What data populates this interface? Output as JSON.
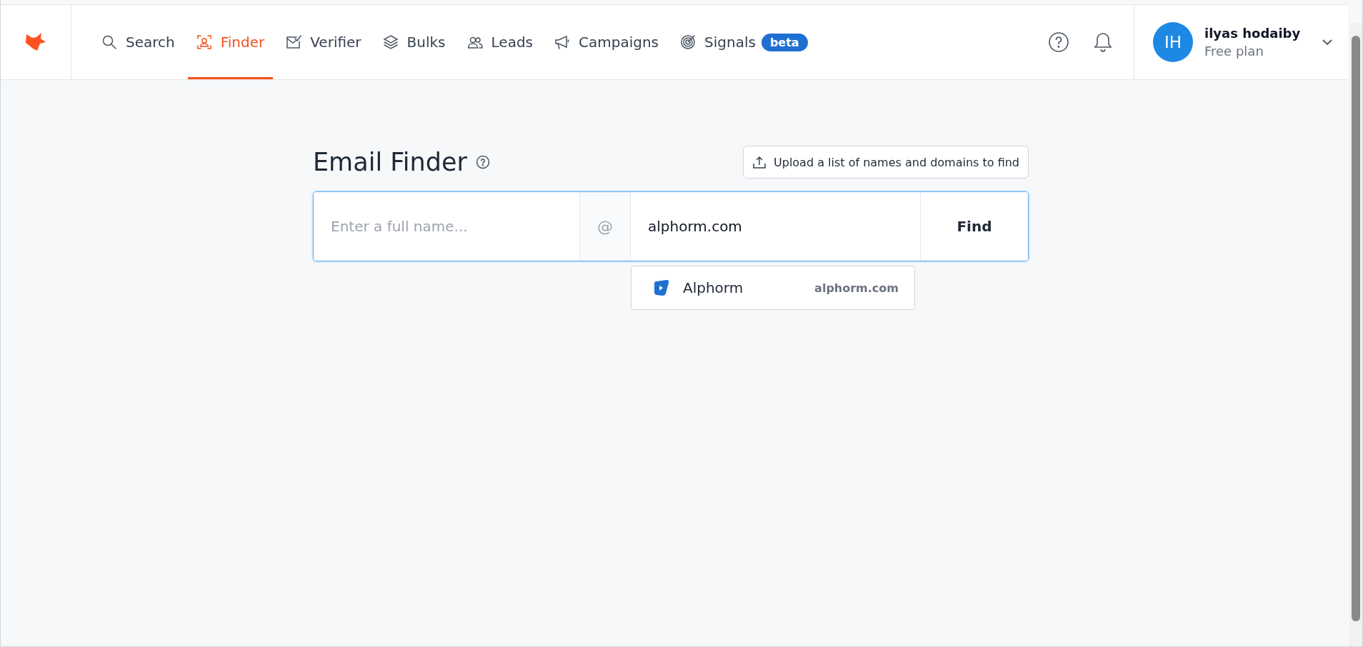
{
  "nav": {
    "tabs": [
      {
        "label": "Search",
        "kind": "search",
        "selected": false
      },
      {
        "label": "Finder",
        "kind": "finder",
        "selected": true
      },
      {
        "label": "Verifier",
        "kind": "verifier",
        "selected": false
      },
      {
        "label": "Bulks",
        "kind": "bulks",
        "selected": false
      },
      {
        "label": "Leads",
        "kind": "leads",
        "selected": false
      },
      {
        "label": "Campaigns",
        "kind": "campaigns",
        "selected": false
      },
      {
        "label": "Signals",
        "kind": "signals",
        "selected": false,
        "badge": "beta"
      }
    ]
  },
  "user": {
    "initials": "IH",
    "name": "ilyas hodaiby",
    "plan": "Free plan"
  },
  "page": {
    "title": "Email Finder",
    "upload_button": "Upload a list of names and domains to find",
    "name_field": {
      "placeholder": "Enter a full name..."
    },
    "at_sign": "@",
    "domain_field": {
      "value": "alphorm.com"
    },
    "find_button": "Find",
    "suggestions": [
      {
        "name": "Alphorm",
        "domain": "alphorm.com"
      }
    ]
  }
}
